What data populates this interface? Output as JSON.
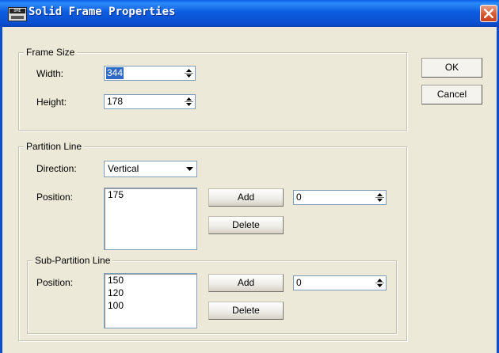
{
  "window": {
    "title": "Solid Frame Properties",
    "app_icon_text": "DME"
  },
  "frame_size": {
    "label": "Frame Size",
    "width_label": "Width:",
    "width_value": "344",
    "height_label": "Height:",
    "height_value": "178"
  },
  "buttons": {
    "ok": "OK",
    "cancel": "Cancel"
  },
  "partition_line": {
    "label": "Partition Line",
    "direction_label": "Direction:",
    "direction_value": "Vertical",
    "position_label": "Position:",
    "positions": [
      "175"
    ],
    "add_label": "Add",
    "delete_label": "Delete",
    "spin_value": "0"
  },
  "sub_partition_line": {
    "label": "Sub-Partition Line",
    "position_label": "Position:",
    "positions": [
      "150",
      "120",
      "100"
    ],
    "add_label": "Add",
    "delete_label": "Delete",
    "spin_value": "0"
  }
}
